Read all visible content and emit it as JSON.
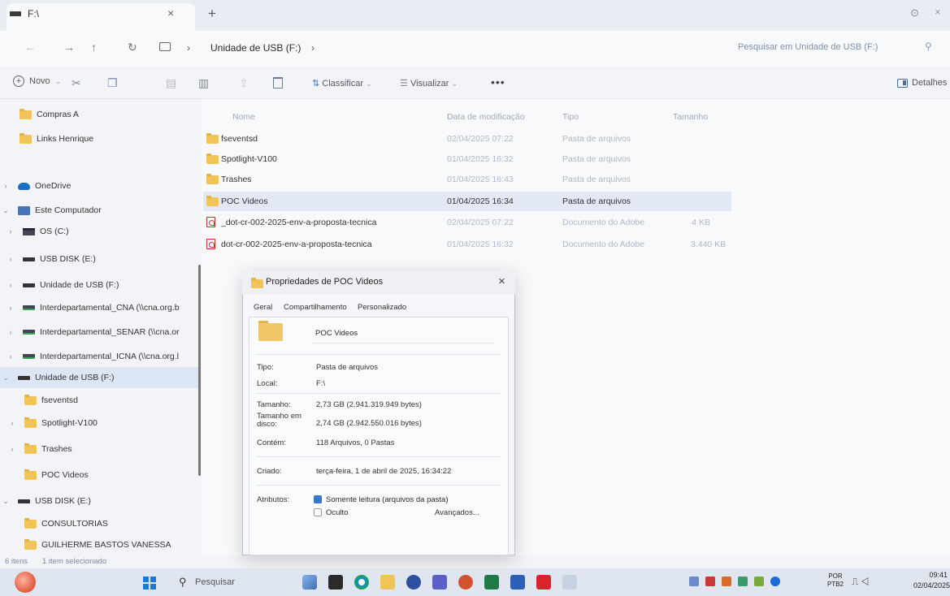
{
  "window": {
    "tab_title": "F:\\",
    "close_tab": "×",
    "new_tab": "+",
    "minimize": "⊙",
    "close": "×"
  },
  "address": {
    "chevron": "›",
    "drive": "Unidade de USB (F:)",
    "search_placeholder": "Pesquisar em Unidade de USB (F:)"
  },
  "toolbar": {
    "new_label": "Novo",
    "sort_label": "Classificar",
    "view_label": "Visualizar",
    "more": "•••",
    "details_label": "Detalhes"
  },
  "navpane": {
    "items": [
      {
        "label": "Compras A",
        "icon": "folder-icon",
        "chev": ""
      },
      {
        "label": "Links Henrique",
        "icon": "folder-icon",
        "chev": ""
      },
      {
        "label": "OneDrive",
        "icon": "cloud-icon",
        "chev": "›"
      },
      {
        "label": "Este Computador",
        "icon": "pc-icon",
        "chev": "⌄"
      },
      {
        "label": "OS (C:)",
        "icon": "os-drive-icon",
        "chev": "›"
      },
      {
        "label": "USB DISK (E:)",
        "icon": "usb-drive-icon",
        "chev": "›"
      },
      {
        "label": "Unidade de USB (F:)",
        "icon": "usb-drive-icon",
        "chev": "›"
      },
      {
        "label": "Interdepartamental_CNA (\\\\cna.org.b",
        "icon": "network-drive-icon",
        "chev": "›"
      },
      {
        "label": "Interdepartamental_SENAR (\\\\cna.or",
        "icon": "network-drive-icon",
        "chev": "›"
      },
      {
        "label": "Interdepartamental_ICNA (\\\\cna.org.l",
        "icon": "network-drive-icon",
        "chev": "›"
      },
      {
        "label": "Unidade de USB (F:)",
        "icon": "usb-drive-icon",
        "chev": "⌄"
      },
      {
        "label": "fseventsd",
        "icon": "folder-icon",
        "chev": ""
      },
      {
        "label": "Spotlight-V100",
        "icon": "folder-icon",
        "chev": "›"
      },
      {
        "label": "Trashes",
        "icon": "folder-icon",
        "chev": "›"
      },
      {
        "label": "POC Videos",
        "icon": "folder-icon",
        "chev": ""
      },
      {
        "label": "USB DISK (E:)",
        "icon": "usb-drive-icon",
        "chev": "⌄"
      },
      {
        "label": "CONSULTORIAS",
        "icon": "folder-icon",
        "chev": ""
      },
      {
        "label": "GUILHERME BASTOS  VANESSA",
        "icon": "folder-icon",
        "chev": ""
      }
    ]
  },
  "filelist": {
    "columns": {
      "name": "Nome",
      "date": "Data de modificação",
      "type": "Tipo",
      "size": "Tamanho"
    },
    "rows": [
      {
        "name": "fseventsd",
        "date": "02/04/2025 07:22",
        "type": "Pasta de arquivos",
        "size": "",
        "icon": "folder-icon",
        "selected": false
      },
      {
        "name": "Spotlight-V100",
        "date": "01/04/2025 16:32",
        "type": "Pasta de arquivos",
        "size": "",
        "icon": "folder-icon",
        "selected": false
      },
      {
        "name": "Trashes",
        "date": "01/04/2025 16:43",
        "type": "Pasta de arquivos",
        "size": "",
        "icon": "folder-icon",
        "selected": false
      },
      {
        "name": "POC Videos",
        "date": "01/04/2025 16:34",
        "type": "Pasta de arquivos",
        "size": "",
        "icon": "folder-icon",
        "selected": true
      },
      {
        "name": "_dot-cr-002-2025-env-a-proposta-tecnica",
        "date": "02/04/2025 07:22",
        "type": "Documento do Adobe",
        "size": "4 KB",
        "icon": "pdf-icon",
        "selected": false
      },
      {
        "name": "dot-cr-002-2025-env-a-proposta-tecnica",
        "date": "01/04/2025 16:32",
        "type": "Documento do Adobe",
        "size": "3.440 KB",
        "icon": "pdf-icon",
        "selected": false
      }
    ]
  },
  "status": {
    "count": "6 itens",
    "selection": "1 item selecionado"
  },
  "dialog": {
    "title": "Propriedades de POC Videos",
    "close": "×",
    "tabs": [
      "Geral",
      "Compartilhamento",
      "Personalizado"
    ],
    "folder_name": "POC Videos",
    "props": {
      "type_label": "Tipo:",
      "type_value": "Pasta de arquivos",
      "local_label": "Local:",
      "local_value": "F:\\",
      "size_label": "Tamanho:",
      "size_value": "2,73 GB (2.941.319.949 bytes)",
      "disk_label": "Tamanho em disco:",
      "disk_value": "2,74 GB (2.942.550.016 bytes)",
      "contains_label": "Contém:",
      "contains_value": "118 Arquivos, 0 Pastas",
      "created_label": "Criado:",
      "created_value": "terça-feira, 1 de abril de 2025, 16:34:22",
      "attr_label": "Atributos:",
      "readonly_label": "Somente leitura (arquivos da pasta)",
      "hidden_label": "Oculto",
      "advanced_button": "Avançados..."
    }
  },
  "taskbar": {
    "search_label": "Pesquisar",
    "lang_line1": "POR",
    "lang_line2": "PTB2",
    "time": "09:41",
    "date": "02/04/2025"
  },
  "colors": {
    "selection": "#e2e8f4",
    "folder": "#f0c458",
    "accent": "#3a78c8"
  }
}
